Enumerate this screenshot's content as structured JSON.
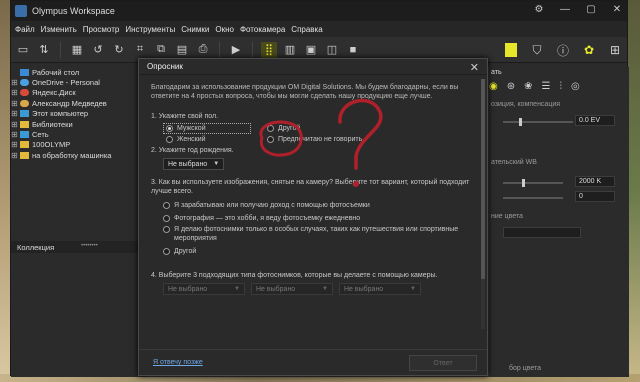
{
  "window": {
    "title": "Olympus Workspace"
  },
  "window_buttons": [
    "⚙",
    "—",
    "▢",
    "✕"
  ],
  "menu": [
    "Файл",
    "Изменить",
    "Просмотр",
    "Инструменты",
    "Снимки",
    "Окно",
    "Фотокамера",
    "Справка"
  ],
  "tree": [
    {
      "label": "Рабочий стол",
      "icon": "desktop-icon",
      "expand": ""
    },
    {
      "label": "OneDrive - Personal",
      "icon": "cloud-icon",
      "expand": "⊞"
    },
    {
      "label": "Яндекс.Диск",
      "icon": "yandex-disk-icon",
      "expand": "⊞"
    },
    {
      "label": "Александр Медведев",
      "icon": "user-folder-icon",
      "expand": "⊞"
    },
    {
      "label": "Этот компьютер",
      "icon": "computer-icon",
      "expand": "⊞"
    },
    {
      "label": "Библиотеки",
      "icon": "folder-icon",
      "expand": "⊞"
    },
    {
      "label": "Сеть",
      "icon": "network-icon",
      "expand": "⊞"
    },
    {
      "label": "100OLYMP",
      "icon": "folder-icon",
      "expand": "⊞"
    },
    {
      "label": "на обработку машинка",
      "icon": "folder-icon",
      "expand": "⊞"
    }
  ],
  "collection": {
    "label": "Коллекция"
  },
  "right_panel": {
    "label_tab": "ать",
    "label1": "озиция, компенсация",
    "exposure_value": "0.0 EV",
    "label2": "ательский WB",
    "wb_value": "2000 K",
    "wb_offset": "0",
    "label3": "ние цвета",
    "bottom_label": "бор цвета"
  },
  "dialog": {
    "title": "Опросник",
    "close": "✕",
    "intro": "Благодарим за использование продукции OM Digital Solutions. Мы будем благодарны, если вы ответите на 4 простых вопроса, чтобы мы могли сделать нашу продукцию еще лучше.",
    "q1": "1. Укажите свой пол.",
    "q1_options": [
      "Мужской",
      "Женский",
      "Другой",
      "Предпочитаю не говорить"
    ],
    "q2": "2. Укажите год рождения.",
    "q2_value": "Не выбрано",
    "q3": "3. Как вы используете изображения, снятые на камеру? Выберите тот вариант, который подходит лучше всего.",
    "q3_options": [
      "Я зарабатываю или получаю доход с помощью фотосъемки",
      "Фотография — это хобби, я веду фотосъемку ежедневно",
      "Я делаю фотоснимки только в особых случаях, таких как путешествия или спортивные мероприятия",
      "Другой"
    ],
    "q4": "4. Выберите 3 подходящих типа фотоснимков, которые вы делаете с помощью камеры.",
    "q4_selects": [
      "Не выбрано",
      "Не выбрано",
      "Не выбрано"
    ],
    "later_link": "Я отвечу позже",
    "ok_button": "Ответ"
  },
  "colors": {
    "accent": "#e6e62a",
    "annotation": "#b0202a",
    "link": "#6fa8e6"
  }
}
